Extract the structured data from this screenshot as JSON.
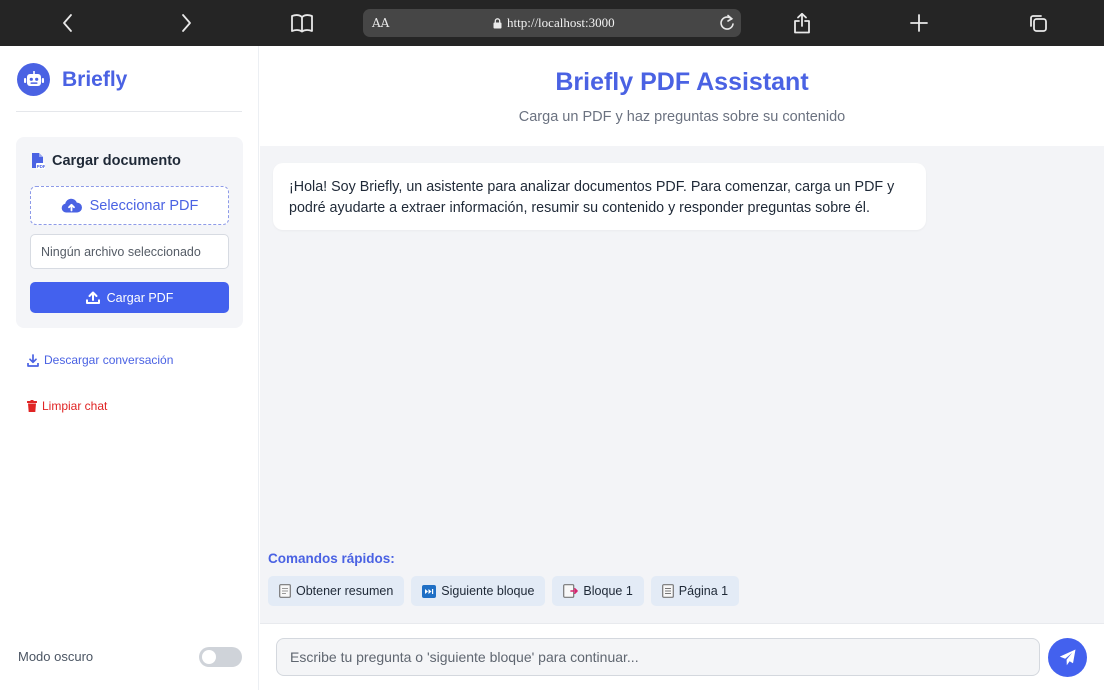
{
  "browser": {
    "text_size_label": "AA",
    "url": "http://localhost:3000"
  },
  "sidebar": {
    "brand": "Briefly",
    "upload_card": {
      "title": "Cargar documento",
      "select_button": "Seleccionar PDF",
      "file_status": "Ningún archivo seleccionado",
      "upload_button": "Cargar PDF"
    },
    "download_link": "Descargar conversación",
    "clear_link": "Limpiar chat",
    "dark_mode_label": "Modo oscuro",
    "dark_mode_on": false
  },
  "header": {
    "title": "Briefly PDF Assistant",
    "subtitle": "Carga un PDF y haz preguntas sobre su contenido"
  },
  "chat": {
    "messages": [
      {
        "sender": "assistant",
        "text": "¡Hola! Soy Briefly, un asistente para analizar documentos PDF. Para comenzar, carga un PDF y podré ayudarte a extraer información, resumir su contenido y responder preguntas sobre él."
      }
    ]
  },
  "quick_commands": {
    "title": "Comandos rápidos:",
    "items": [
      {
        "icon": "page-icon",
        "label": "Obtener resumen"
      },
      {
        "icon": "next-track-icon",
        "label": "Siguiente bloque"
      },
      {
        "icon": "page-arrow-icon",
        "label": "Bloque 1"
      },
      {
        "icon": "page-lines-icon",
        "label": "Página 1"
      }
    ]
  },
  "input": {
    "placeholder": "Escribe tu pregunta o 'siguiente bloque' para continuar...",
    "value": ""
  },
  "colors": {
    "accent": "#4a62e3",
    "button": "#4361ee",
    "danger": "#e02424",
    "chip_bg": "#e3ebf6"
  }
}
